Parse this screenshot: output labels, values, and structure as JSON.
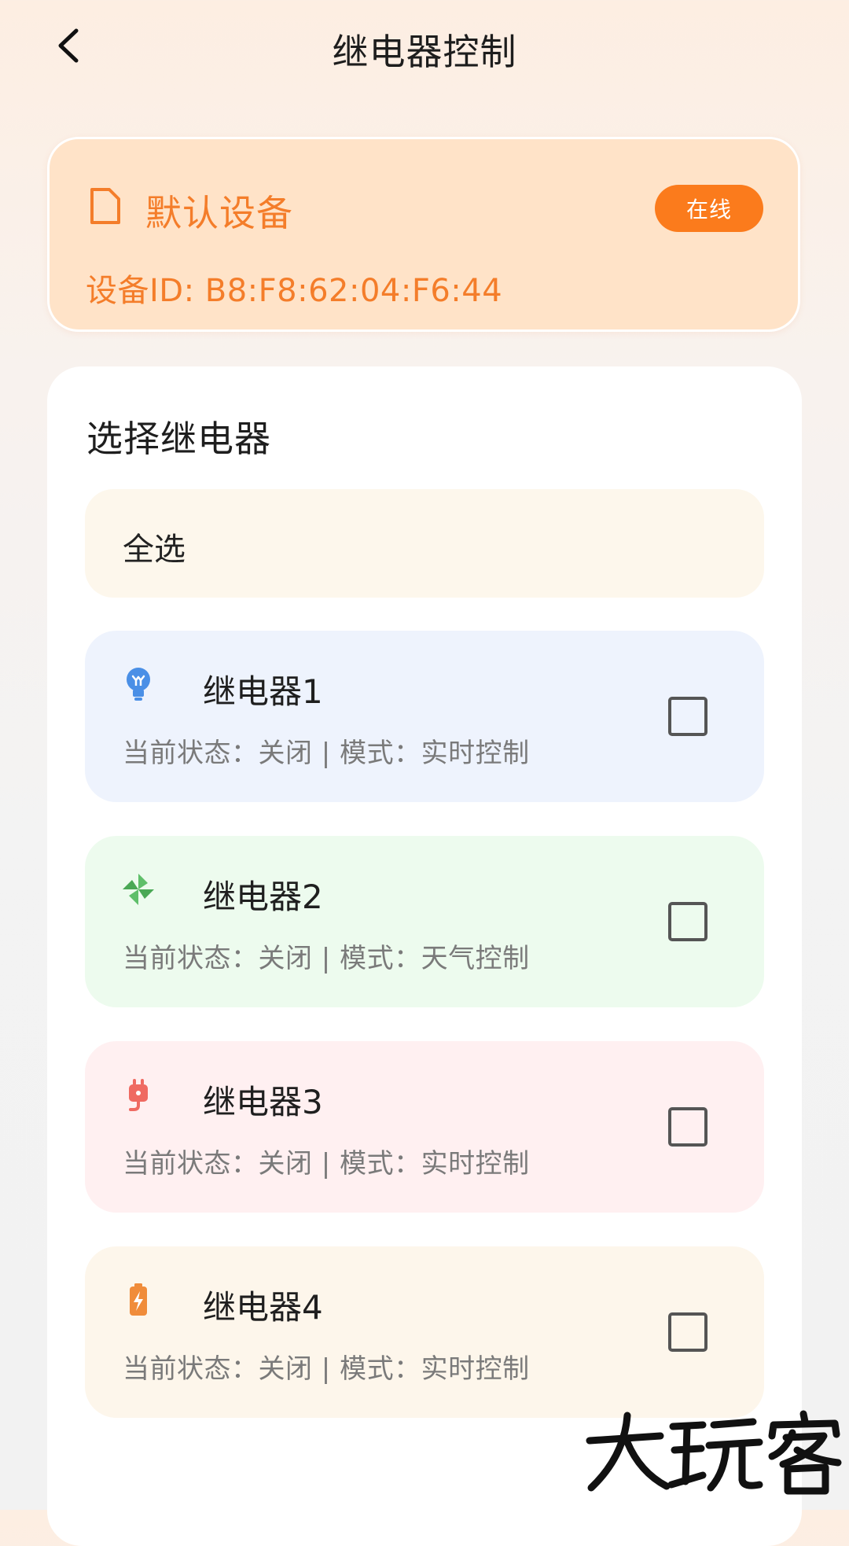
{
  "header": {
    "title": "继电器控制"
  },
  "device": {
    "name": "默认设备",
    "status": "在线",
    "id_text": "设备ID: B8:F8:62:04:F6:44"
  },
  "selection": {
    "section_title": "选择继电器",
    "select_all_label": "全选"
  },
  "relays": [
    {
      "name": "继电器1",
      "status_text": "当前状态：关闭 | 模式：实时控制",
      "icon": "lightbulb-icon",
      "bg": "#eef3fd",
      "accent": "#4a8fe6",
      "checked": false
    },
    {
      "name": "继电器2",
      "status_text": "当前状态：关闭 | 模式：天气控制",
      "icon": "pinwheel-icon",
      "bg": "#edfbee",
      "accent": "#5fbf6a",
      "checked": false
    },
    {
      "name": "继电器3",
      "status_text": "当前状态：关闭 | 模式：实时控制",
      "icon": "plug-icon",
      "bg": "#fff0f1",
      "accent": "#ef6a62",
      "checked": false
    },
    {
      "name": "继电器4",
      "status_text": "当前状态：关闭 | 模式：实时控制",
      "icon": "battery-charging-icon",
      "bg": "#fdf6eb",
      "accent": "#f08c3a",
      "checked": false
    }
  ],
  "watermark": {
    "text": "大玩客"
  },
  "colors": {
    "brand_orange": "#fb7b1c",
    "device_text": "#f47d2a",
    "device_card_bg": "#ffe3c8"
  }
}
